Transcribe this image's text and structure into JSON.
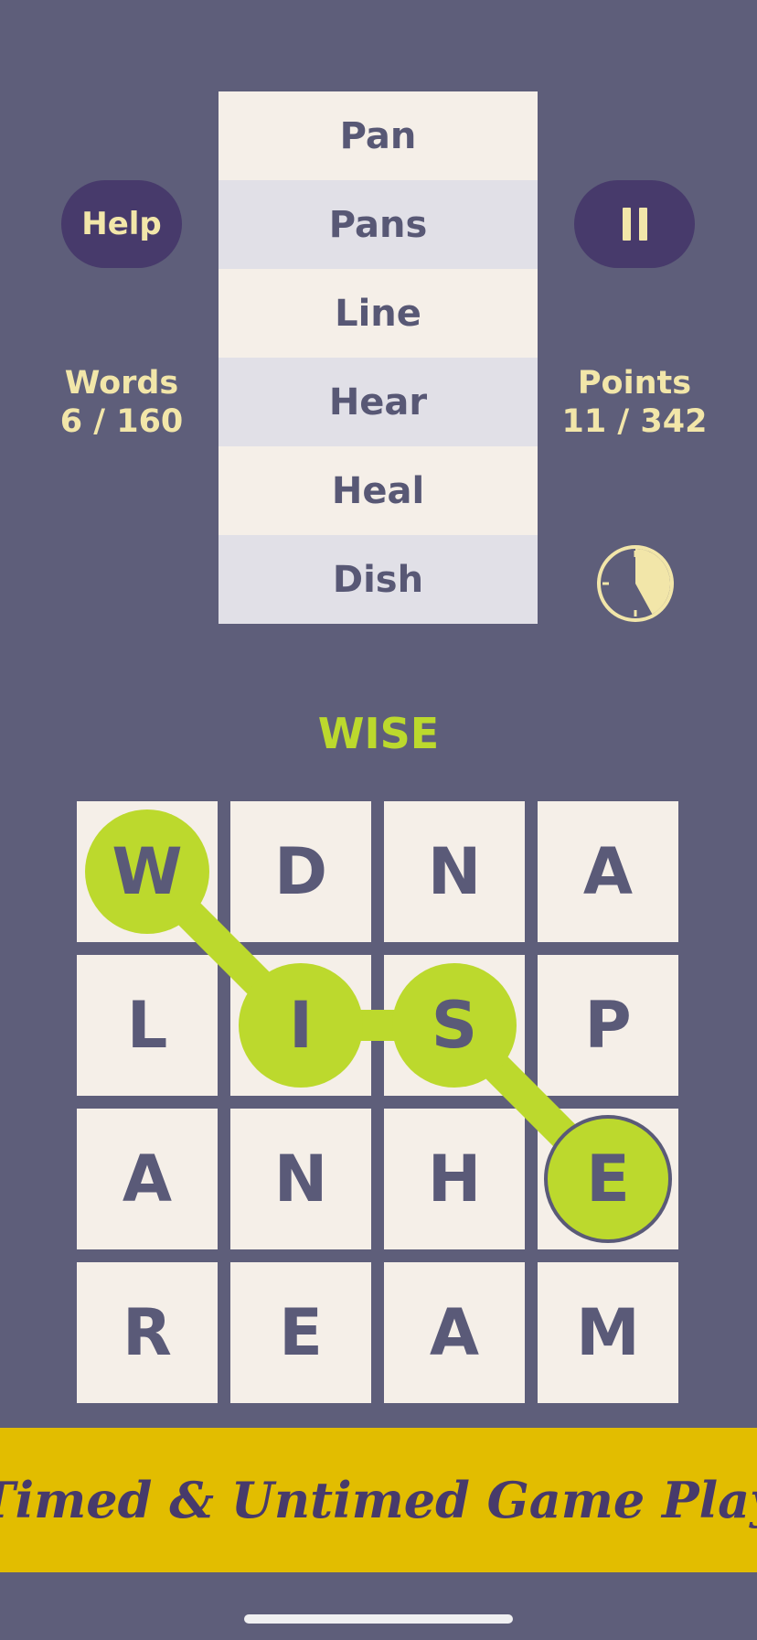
{
  "header": {
    "help_label": "Help",
    "pause_icon": "pause-icon",
    "words_label": "Words",
    "words_value": "6 / 160",
    "points_label": "Points",
    "points_value": "11 / 342",
    "timer_icon": "clock-timer-icon",
    "timer_remaining_fraction": 0.42
  },
  "found_words": [
    "Pan",
    "Pans",
    "Line",
    "Hear",
    "Heal",
    "Dish"
  ],
  "current_word": "WISE",
  "board": {
    "letters": [
      [
        "W",
        "D",
        "N",
        "A"
      ],
      [
        "L",
        "I",
        "S",
        "P"
      ],
      [
        "A",
        "N",
        "H",
        "E"
      ],
      [
        "R",
        "E",
        "A",
        "M"
      ]
    ],
    "selected_path": [
      [
        0,
        0
      ],
      [
        1,
        1
      ],
      [
        1,
        2
      ],
      [
        2,
        3
      ]
    ]
  },
  "banner": {
    "text": "Timed & Untimed Game Play"
  },
  "colors": {
    "background": "#5e5e7a",
    "button": "#473a6b",
    "accent_text": "#f2e6a9",
    "selection": "#bcd92d",
    "banner": "#e2bd00",
    "tile": "#f5efe8"
  }
}
